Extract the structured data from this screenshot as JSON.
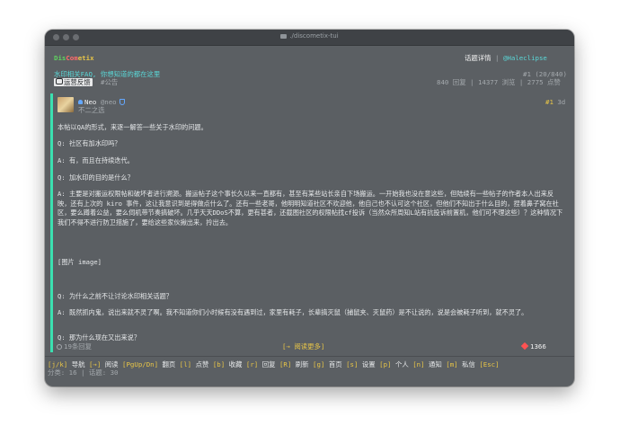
{
  "window": {
    "title": "./discometix-tui"
  },
  "header": {
    "logo": {
      "part1": "Dis",
      "part2": "Com",
      "part3": "etix"
    },
    "nav": {
      "label": "话题详情",
      "sep": "|",
      "user": "@Haleclipse"
    }
  },
  "topic": {
    "title": "水印相关FAQ, 你想知道的都在这里",
    "tags": {
      "active": "运营反馈",
      "other": "#公告"
    },
    "position": "#1 (20/840)",
    "stats": {
      "replies": "840 回复",
      "sep1": "|",
      "views": "14377 浏览",
      "sep2": "|",
      "likes": "2775 点赞"
    }
  },
  "post": {
    "username": "Neo",
    "handle": "@neo",
    "subtitle": "不二之选",
    "number": "#1",
    "age": "3d",
    "paragraphs": [
      "本帖以QA的形式，来逐一解答一些关于水印的问题。",
      "Q: 社区有加水印吗？",
      "A: 有，而且在持续迭代。",
      "Q: 加水印的目的是什么？",
      "A: 主要是对搬运权限帖和破坏者进行溯源。搬运帖子这个事长久以来一直都有，甚至有某些站长亲自下场搬运。一开始我也没在意这些，但陆续有一些帖子的作者本人出来反映，还有上次的 kiro 事件，这让我意识到是得做点什么了。还有一些老哥，他明明知道社区不欢迎他，他自己也不认可这个社区，但他们不知出于什么目的，捏着鼻子窝在社区，要么蹲着公益，要么伺机带节奏搞破坏。几乎天天DDoS不算，更有甚者，还截图社区的权限帖找cf投诉（当然众所周知L站有抗投诉前置机，他们可不理这些）？这种情况下我们不得不进行防卫措施了，要给这些家伙揪出来，拎出去。",
      "[图片 image]",
      "Q: 为什么之前不让讨论水印相关话题？",
      "A: 既然抓内鬼，说出来就不灵了啊。我不知道你们小时候有没有遇到过，家里有耗子，长辈搞灭鼠（捕鼠夹、灭鼠药）是不让说的，说是会被耗子听到，就不灵了。",
      "Q: 那为什么现在又出来说？"
    ],
    "replies": "19条回复",
    "read_more": "[→ 阅读更多]",
    "likes": "1366"
  },
  "footer": {
    "shortcuts": [
      {
        "key": "[j/k]",
        "label": "导航"
      },
      {
        "key": "[→]",
        "label": "阅读"
      },
      {
        "key": "[PgUp/Dn]",
        "label": "翻页"
      },
      {
        "key": "[l]",
        "label": "点赞"
      },
      {
        "key": "[b]",
        "label": "收藏"
      },
      {
        "key": "[r]",
        "label": "回复"
      },
      {
        "key": "[R]",
        "label": "刷新"
      },
      {
        "key": "[g]",
        "label": "首页"
      },
      {
        "key": "[s]",
        "label": "设置"
      },
      {
        "key": "[p]",
        "label": "个人"
      },
      {
        "key": "[n]",
        "label": "通知"
      },
      {
        "key": "[m]",
        "label": "私信"
      },
      {
        "key": "[Esc]",
        "label": ""
      }
    ],
    "stats": "分类: 16 | 话题: 30"
  }
}
